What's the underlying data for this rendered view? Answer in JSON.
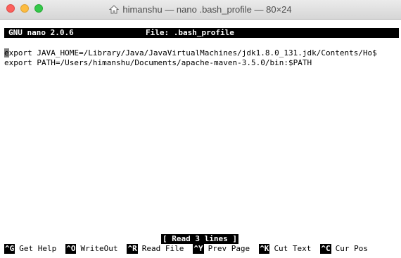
{
  "window": {
    "title": "himanshu — nano .bash_profile — 80×24"
  },
  "nano": {
    "version": "GNU nano 2.0.6",
    "file_label": "File: .bash_profile",
    "lines": [
      "export JAVA_HOME=/Library/Java/JavaVirtualMachines/jdk1.8.0_131.jdk/Contents/Ho$",
      "export PATH=/Users/himanshu/Documents/apache-maven-3.5.0/bin:$PATH"
    ],
    "message": "[ Read 3 lines ]",
    "shortcuts": [
      {
        "key": "^G",
        "label": "Get Help"
      },
      {
        "key": "^O",
        "label": "WriteOut"
      },
      {
        "key": "^R",
        "label": "Read File"
      },
      {
        "key": "^Y",
        "label": "Prev Page"
      },
      {
        "key": "^K",
        "label": "Cut Text"
      },
      {
        "key": "^C",
        "label": "Cur Pos"
      }
    ]
  },
  "icons": {
    "title_icon": "home-icon"
  },
  "colors": {
    "close": "#fc605c",
    "minimize": "#fdbc40",
    "zoom": "#34c84a"
  }
}
